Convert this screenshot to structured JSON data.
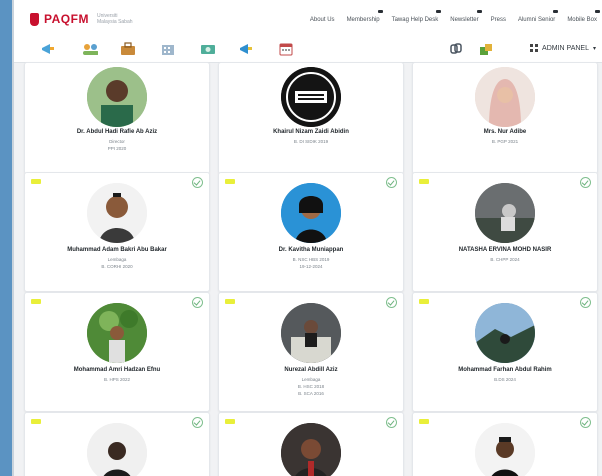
{
  "header": {
    "logo_text": "PAQFM",
    "logo_sub_line1": "Universiti",
    "logo_sub_line2": "Malaysia Sabah",
    "nav": [
      "About Us",
      "Membership",
      "Tawag Help Desk",
      "Newsletter",
      "Press",
      "Alumni Senior",
      "Mobile Box"
    ],
    "admin_label": "ADMIN PANEL"
  },
  "toolbar_icons": [
    "megaphone-icon",
    "people-icon",
    "briefcase-icon",
    "building-icon",
    "money-icon",
    "announcement-icon",
    "calendar-icon"
  ],
  "toolbar_right_icons": [
    "link-icon",
    "group-icon",
    "grid-icon"
  ],
  "cards": [
    {
      "name": "Dr. Abdul Hadi Rafie Ab Aziz",
      "line1": "Director",
      "line2": "PPI 2020",
      "line3": ""
    },
    {
      "name": "Khairul Nizam Zaidi Abidin",
      "line1": "B. DI SIDIK 2019",
      "line2": "",
      "line3": ""
    },
    {
      "name": "Mrs. Nur Adibe",
      "line1": "B. PGP 2021",
      "line2": "",
      "line3": ""
    },
    {
      "name": "Muhammad Adam Bakri Abu Bakar",
      "line1": "Lembaga",
      "line2": "B. CORHI 2020",
      "line3": ""
    },
    {
      "name": "Dr. Kavitha Muniappan",
      "line1": "B. NSC HBS 2019",
      "line2": "19-12-2024",
      "line3": ""
    },
    {
      "name": "NATASHA ERVINA MOHD NASIR",
      "line1": "B. CHPP 2024",
      "line2": "",
      "line3": ""
    },
    {
      "name": "Mohammad Amri Hadzan Efnu",
      "line1": "B. HPS 2022",
      "line2": "",
      "line3": ""
    },
    {
      "name": "Nurezal Abdill Aziz",
      "line1": "Lembaga",
      "line2": "B. HSC 2018",
      "line3": "B. SCA 2016"
    },
    {
      "name": "Mohammad Farhan Abdul Rahim",
      "line1": "B.DS 2024",
      "line2": "",
      "line3": ""
    },
    {
      "name": "",
      "line1": "",
      "line2": "",
      "line3": ""
    },
    {
      "name": "",
      "line1": "",
      "line2": "",
      "line3": ""
    },
    {
      "name": "",
      "line1": "",
      "line2": "",
      "line3": ""
    }
  ],
  "colors": {
    "brand": "#c8102e",
    "badge": "#e9ef3a",
    "check": "#7fbf8e",
    "background": "#f1f2f4"
  }
}
